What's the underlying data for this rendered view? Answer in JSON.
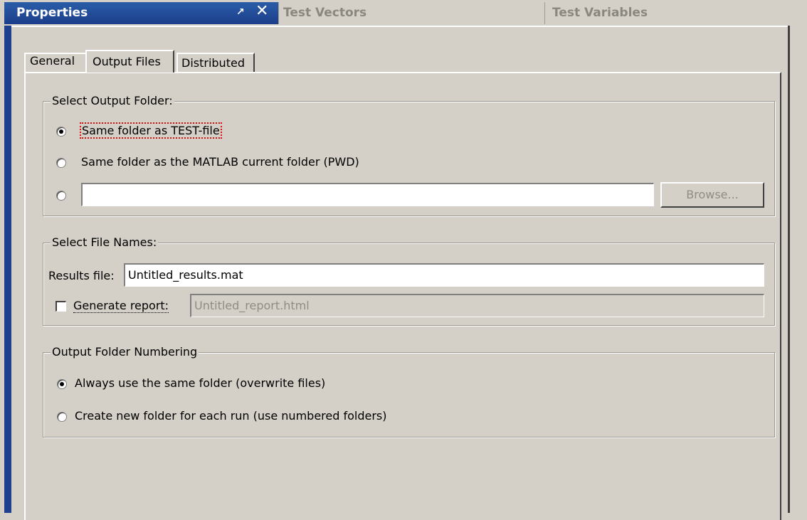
{
  "titlebar": {
    "properties_tab": "Properties",
    "undock_icon": "↗",
    "close_icon": "✕",
    "test_vectors_tab": "Test Vectors",
    "test_variables_tab": "Test Variables"
  },
  "property_tabs": [
    {
      "label": "General",
      "selected": false
    },
    {
      "label": "Output Files",
      "selected": true
    },
    {
      "label": "Distributed",
      "selected": false
    }
  ],
  "output_folder": {
    "legend": "Select Output Folder:",
    "options": [
      {
        "label": "Same folder as TEST-file",
        "selected": true
      },
      {
        "label": "Same folder as the MATLAB current folder (PWD)",
        "selected": false
      },
      {
        "label": "",
        "selected": false
      }
    ],
    "custom_path_value": "",
    "browse_label": "Browse..."
  },
  "file_names": {
    "legend": "Select File Names:",
    "results_label": "Results file:",
    "results_value": "Untitled_results.mat",
    "report_label": "Generate report:",
    "report_checked": false,
    "report_value": "Untitled_report.html"
  },
  "numbering": {
    "legend": "Output Folder Numbering",
    "options": [
      {
        "label": "Always use the same folder (overwrite files)",
        "selected": true
      },
      {
        "label": "Create new folder for each run (use numbered folders)",
        "selected": false
      }
    ]
  },
  "colors": {
    "active_tab": "#1c3e8a",
    "panel_bg": "#d4d0c8",
    "focus_outline": "#e01010"
  }
}
